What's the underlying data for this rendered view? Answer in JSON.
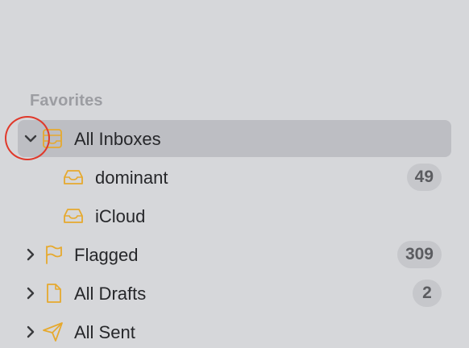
{
  "sidebar": {
    "section_title": "Favorites",
    "items": [
      {
        "label": "All Inboxes",
        "icon": "inbox-stack-icon",
        "expanded": true,
        "selected": true,
        "badge": ""
      },
      {
        "label": "dominant",
        "icon": "inbox-tray-icon",
        "badge": "49"
      },
      {
        "label": "iCloud",
        "icon": "inbox-tray-icon",
        "badge": ""
      },
      {
        "label": "Flagged",
        "icon": "flag-icon",
        "expanded": false,
        "badge": "309"
      },
      {
        "label": "All Drafts",
        "icon": "document-icon",
        "expanded": false,
        "badge": "2"
      },
      {
        "label": "All Sent",
        "icon": "paper-plane-icon",
        "expanded": false,
        "badge": ""
      }
    ]
  },
  "colors": {
    "background": "#d6d7da",
    "selection": "#bdbec3",
    "icon_accent": "#e6a92e",
    "badge_bg": "#c6c7cb",
    "highlight_circle": "#e0392b"
  }
}
